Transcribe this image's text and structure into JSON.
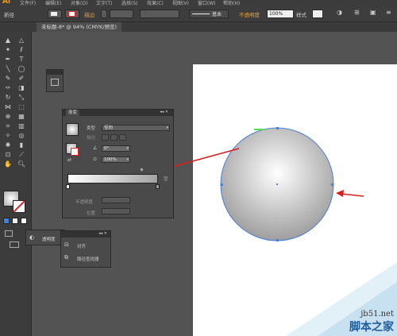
{
  "app": {
    "logo": "Ai",
    "menus": [
      "文件(F)",
      "编辑(E)",
      "对象(O)",
      "文字(T)",
      "选择(S)",
      "效果(C)",
      "视图(V)",
      "窗口(W)",
      "帮助(H)"
    ]
  },
  "control_bar": {
    "mode_label": "新径",
    "stroke_label": "描边",
    "stroke_style_label": "基本",
    "opacity_label": "不透明度",
    "opacity_value": "100%",
    "style_label": "样式"
  },
  "document_tab": {
    "title": "未标题-8* @ 94% (CMYK/预览)"
  },
  "gradient_panel": {
    "title": "渐变",
    "type_label": "类型",
    "type_value": "径向",
    "stroke_label": "描边",
    "angle_value": "0°",
    "aspect_value": "100%",
    "opacity_label": "不透明度",
    "location_label": "位置"
  },
  "transparency_panel": {
    "title": "透明度"
  },
  "align_panel": {
    "items": [
      {
        "label": "对齐"
      },
      {
        "label": "路径查找器"
      }
    ]
  },
  "watermark": {
    "site": "jb51.net",
    "brand": "脚本之家"
  },
  "colors": {
    "accent": "#ff9a00",
    "annotation_arrow": "#d81e1e",
    "selection": "#4a7fd4"
  }
}
